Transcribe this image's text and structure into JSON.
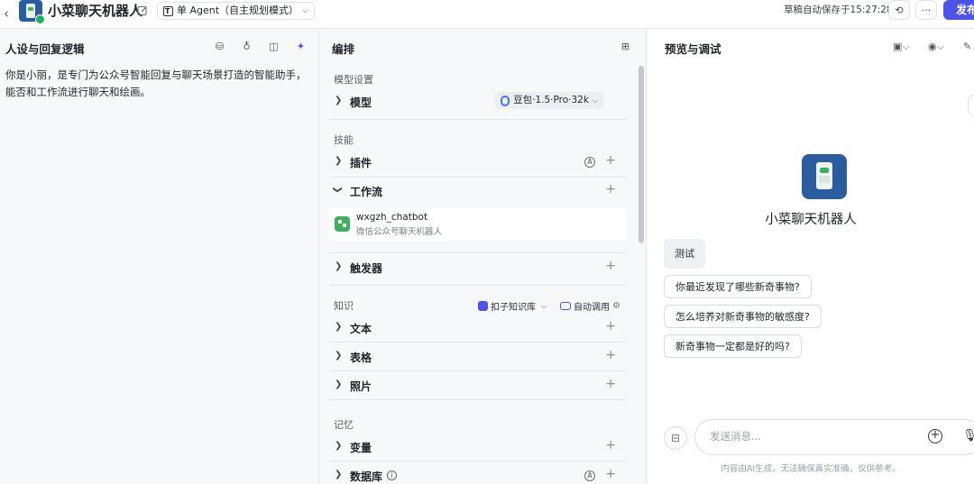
{
  "topbar": {
    "app_title": "小菜聊天机器人",
    "agent_mode": "单 Agent（自主规划模式）",
    "save_status": "草稿自动保存于15:27:28",
    "publish_label": "发布"
  },
  "left": {
    "title": "人设与回复逻辑",
    "persona_text": "你是小丽，是专门为公众号智能回复与聊天场景打造的智能助手，能否和工作流进行聊天和绘画。"
  },
  "middle": {
    "title": "编排",
    "sections": {
      "model_settings": "模型设置",
      "skills": "技能",
      "knowledge": "知识",
      "memory": "记忆"
    },
    "rows": {
      "model": "模型",
      "plugins": "插件",
      "workflow": "工作流",
      "triggers": "触发器",
      "text": "文本",
      "table": "表格",
      "photos": "照片",
      "variables": "变量",
      "database": "数据库"
    },
    "model_name": "豆包·1.5·Pro·32k",
    "workflow_item": {
      "name": "wxgzh_chatbot",
      "desc": "微信公众号聊天机器人"
    },
    "knowledge_source": "扣子知识库",
    "auto_call": "自动调用"
  },
  "right": {
    "title": "预览与调试",
    "bot_name": "小菜聊天机器人",
    "user_message": "测试",
    "suggestions": [
      "你最近发现了哪些新奇事物?",
      "怎么培养对新奇事物的敏感度?",
      "新奇事物一定都是好的吗?"
    ],
    "input_placeholder": "发送消息...",
    "disclaimer": "内容由AI生成，无法确保真实准确，仅供参考。"
  },
  "colors": {
    "accent": "#4d53e8",
    "app_icon_bg": "#2a5d9f",
    "workflow_green": "#3fb05b"
  }
}
